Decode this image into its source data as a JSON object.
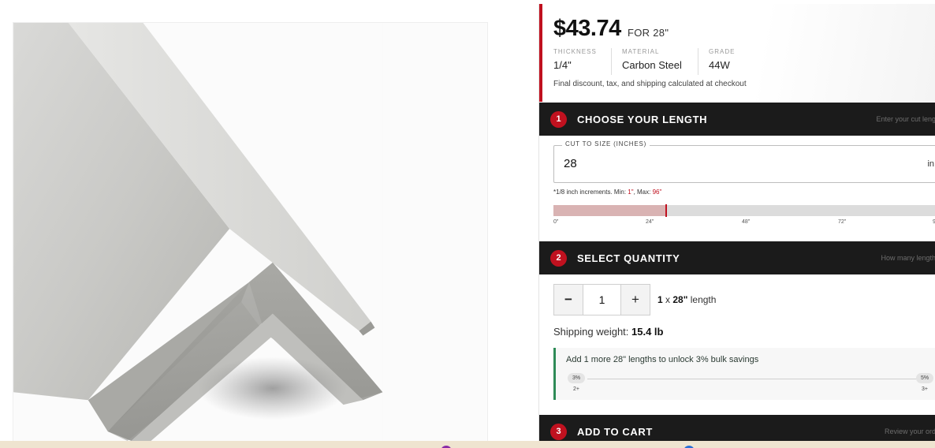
{
  "product": {
    "price": "$43.74",
    "price_for": "FOR 28\"",
    "specs": [
      {
        "label": "THICKNESS",
        "value": "1/4\""
      },
      {
        "label": "MATERIAL",
        "value": "Carbon Steel"
      },
      {
        "label": "GRADE",
        "value": "44W"
      }
    ],
    "checkout_note": "Final discount, tax, and shipping calculated at checkout"
  },
  "steps": [
    {
      "number": "1",
      "title": "CHOOSE YOUR LENGTH",
      "hint": "Enter your cut leng"
    },
    {
      "number": "2",
      "title": "SELECT QUANTITY",
      "hint": "How many length"
    },
    {
      "number": "3",
      "title": "ADD TO CART",
      "hint": "Review your ord"
    }
  ],
  "length": {
    "legend": "CUT TO SIZE (INCHES)",
    "value": "28",
    "unit": "in",
    "note_prefix": "*1/8 inch increments. Min: ",
    "min": "1\"",
    "note_mid": ", Max: ",
    "max": "96\"",
    "slider_fraction": 0.292,
    "ticks": [
      "0\"",
      "24\"",
      "48\"",
      "72\"",
      "9"
    ]
  },
  "quantity": {
    "minus_label": "−",
    "plus_label": "+",
    "value": "1",
    "summary_count": "1",
    "summary_mid": " x ",
    "summary_length": "28\"",
    "summary_suffix": " length"
  },
  "shipping": {
    "label": "Shipping weight: ",
    "value": "15.4 lb"
  },
  "bulk": {
    "message": "Add 1 more 28\" lengths to unlock 3% bulk savings",
    "tiers": [
      {
        "pct": "3%",
        "qty": "2+"
      },
      {
        "pct": "5%",
        "qty": "3+"
      }
    ]
  },
  "colors": {
    "accent_red": "#c0111f",
    "step_bar": "#1b1b1b",
    "bulk_green": "#2e8b57"
  },
  "icons": {
    "product_image": "steel-angle-bar-image"
  }
}
